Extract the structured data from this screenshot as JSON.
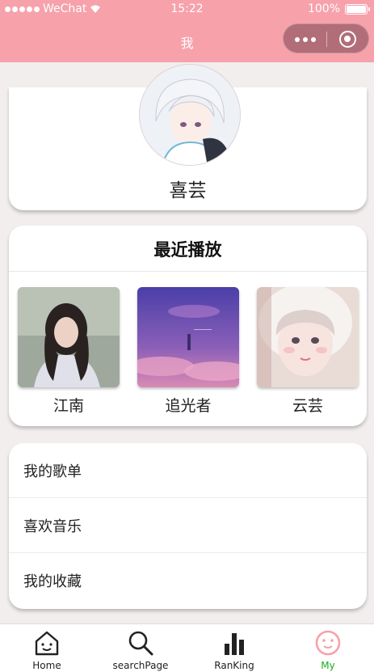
{
  "status_bar": {
    "carrier": "WeChat",
    "time": "15:22",
    "battery": "100%"
  },
  "nav": {
    "title": "我"
  },
  "profile": {
    "username": "喜芸"
  },
  "recent": {
    "title": "最近播放",
    "items": [
      {
        "name": "江南"
      },
      {
        "name": "追光者"
      },
      {
        "name": "云芸"
      }
    ]
  },
  "menu": {
    "items": [
      {
        "label": "我的歌单"
      },
      {
        "label": "喜欢音乐"
      },
      {
        "label": "我的收藏"
      }
    ]
  },
  "tabbar": {
    "items": [
      {
        "label": "Home",
        "icon": "home-icon"
      },
      {
        "label": "searchPage",
        "icon": "search-icon"
      },
      {
        "label": "RanKing",
        "icon": "ranking-icon"
      },
      {
        "label": "My",
        "icon": "my-icon"
      }
    ],
    "active": "My"
  },
  "colors": {
    "header": "#f7a1ab",
    "active_tab": "#1aad19",
    "background": "#f2eeee"
  }
}
